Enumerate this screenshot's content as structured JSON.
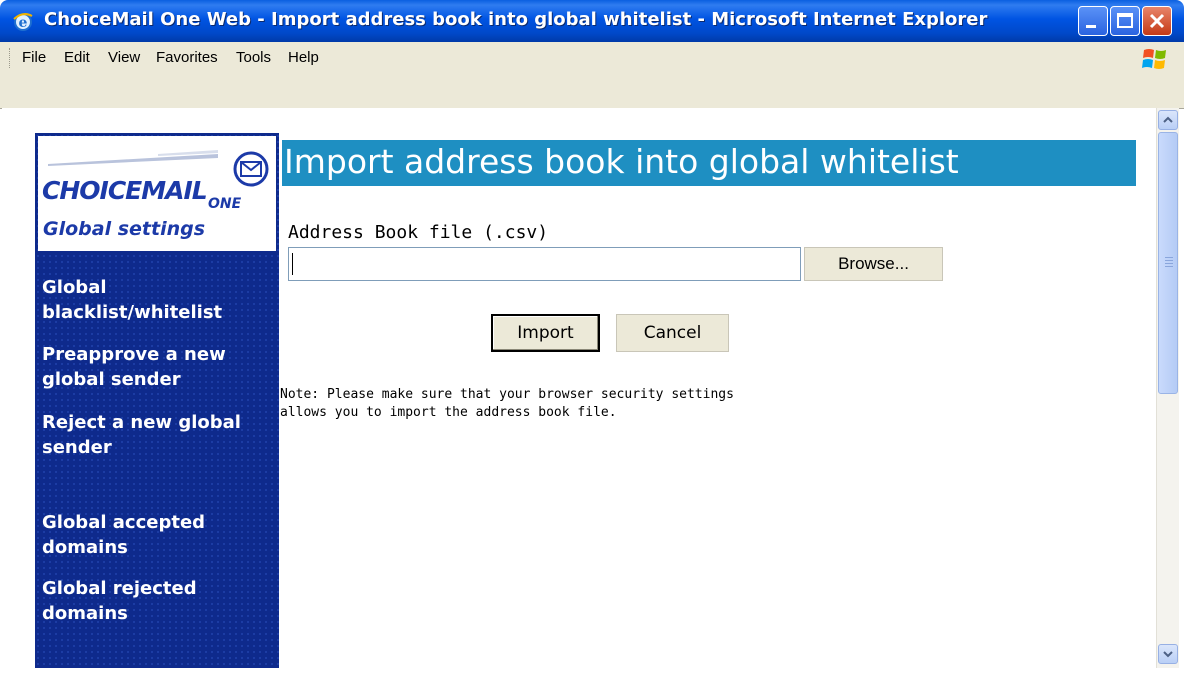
{
  "window": {
    "title": "ChoiceMail One Web - Import address book into global whitelist - Microsoft Internet Explorer"
  },
  "menu": [
    {
      "label": "File"
    },
    {
      "label": "Edit"
    },
    {
      "label": "View"
    },
    {
      "label": "Favorites"
    },
    {
      "label": "Tools"
    },
    {
      "label": "Help"
    }
  ],
  "sidebar": {
    "logo_main": "CHOICEMAIL",
    "logo_one": "ONE",
    "section": "Global settings",
    "links": [
      {
        "label": "Global blacklist/whitelist"
      },
      {
        "label": "Preapprove a new global sender"
      },
      {
        "label": "Reject a new global sender"
      },
      {
        "label": "Global accepted domains"
      },
      {
        "label": "Global rejected domains"
      }
    ]
  },
  "main": {
    "title": "Import address book into global whitelist",
    "field_label": "Address Book file (.csv)",
    "file_value": "",
    "browse_label": "Browse...",
    "import_label": "Import",
    "cancel_label": "Cancel",
    "note_line1": "Note: Please make sure that your browser security settings",
    "note_line2": "allows you to import the address book file."
  },
  "colors": {
    "title_bar": "#0054e3",
    "sidebar_bg": "#0e2a8c",
    "page_title_bg": "#1e8fc2",
    "logo_blue": "#1c3aa8"
  }
}
